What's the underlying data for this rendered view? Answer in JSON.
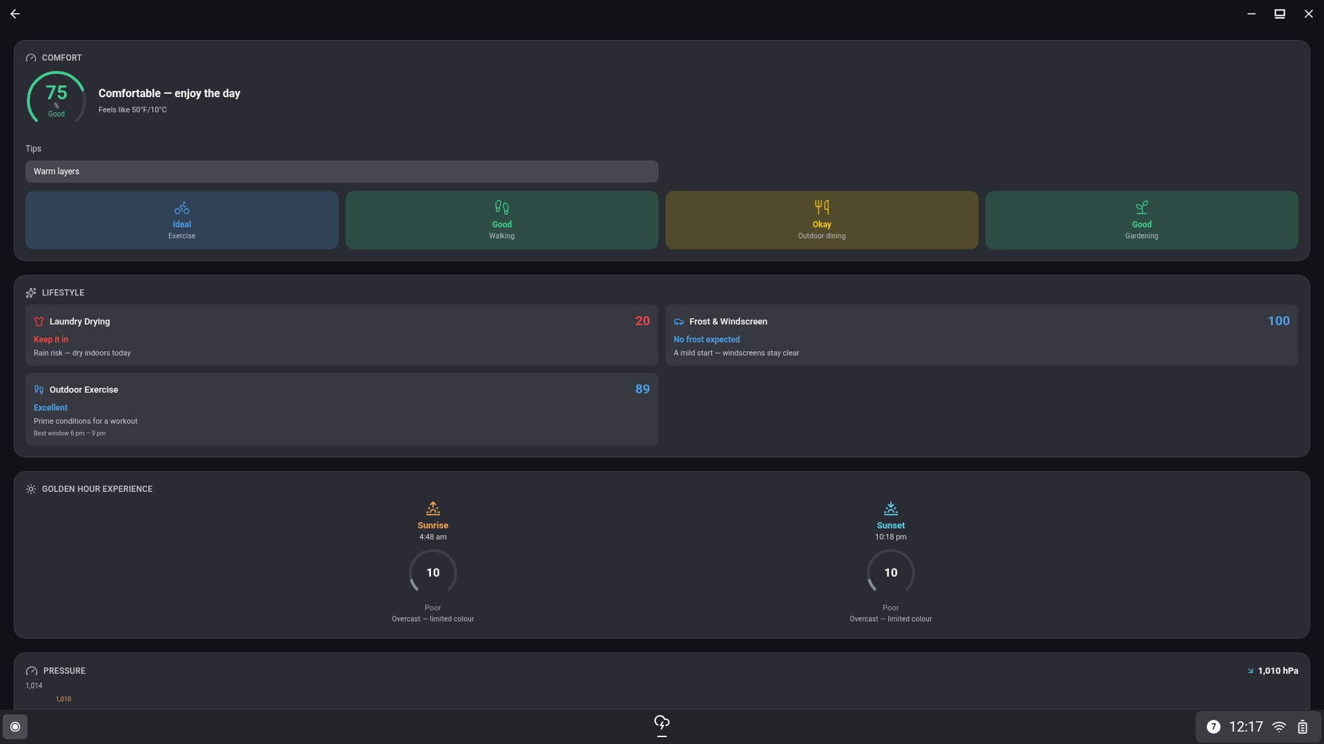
{
  "comfort": {
    "heading": "COMFORT",
    "score": "75",
    "unit": "%",
    "rating": "Good",
    "level": 0.75,
    "title": "Comfortable — enjoy the day",
    "feels_like": "Feels like 50°F/10°C",
    "tips_label": "Tips",
    "tips": [
      "Warm layers"
    ],
    "activities": [
      {
        "kind": "exercise",
        "rating": "Ideal",
        "name": "Exercise",
        "color": "#4a9fe8"
      },
      {
        "kind": "walking",
        "rating": "Good",
        "name": "Walking",
        "color": "#3ecf8e"
      },
      {
        "kind": "dining",
        "rating": "Okay",
        "name": "Outdoor dining",
        "color": "#f2c811"
      },
      {
        "kind": "gardening",
        "rating": "Good",
        "name": "Gardening",
        "color": "#3ecf8e"
      }
    ]
  },
  "lifestyle": {
    "heading": "LIFESTYLE",
    "items": [
      {
        "kind": "laundry",
        "title": "Laundry Drying",
        "score": "20",
        "status": "Keep it in",
        "description": "Rain risk — dry indoors today",
        "color": "#ef4444"
      },
      {
        "kind": "frost",
        "title": "Frost & Windscreen",
        "score": "100",
        "status": "No frost expected",
        "description": "A mild start — windscreens stay clear",
        "color": "#4a9fe8"
      },
      {
        "kind": "exercise",
        "title": "Outdoor Exercise",
        "score": "89",
        "status": "Excellent",
        "description": "Prime conditions for a workout",
        "note": "Best window 6 pm – 9 pm",
        "color": "#4a9fe8"
      }
    ]
  },
  "golden_hour": {
    "heading": "GOLDEN HOUR EXPERIENCE",
    "events": [
      {
        "kind": "sunrise",
        "label": "Sunrise",
        "time": "4:48 am",
        "score": "10",
        "level": 0.1,
        "rating": "Poor",
        "description": "Overcast — limited colour",
        "color": "#f5a64a"
      },
      {
        "kind": "sunset",
        "label": "Sunset",
        "time": "10:18 pm",
        "score": "10",
        "level": 0.1,
        "rating": "Poor",
        "description": "Overcast — limited colour",
        "color": "#5fd3f0"
      }
    ]
  },
  "pressure": {
    "heading": "PRESSURE",
    "reading": "1,010 hPa",
    "axis_label": "1,014",
    "point_label": "1,010"
  },
  "taskbar": {
    "notification_count": "7",
    "time": "12:17"
  }
}
